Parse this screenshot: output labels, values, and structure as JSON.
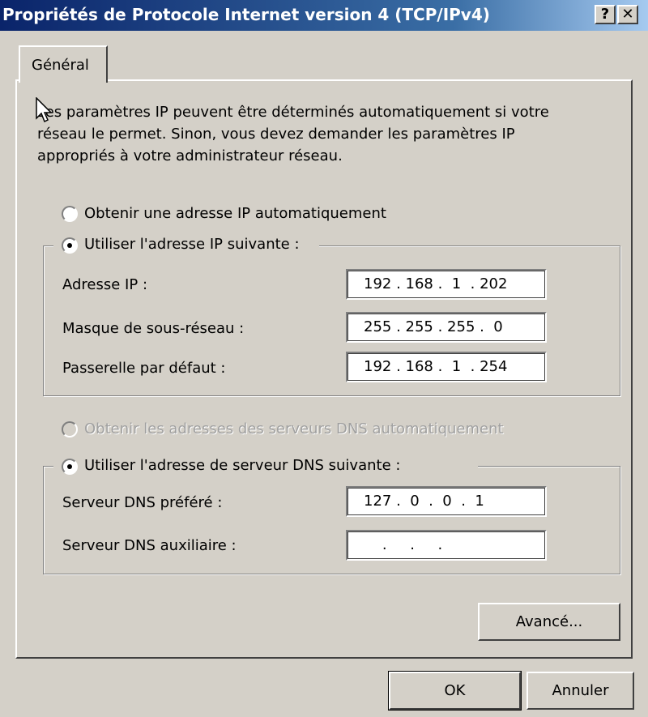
{
  "window": {
    "title": "Propriétés de Protocole Internet version 4 (TCP/IPv4)",
    "help_button": "?",
    "close_button": "✕"
  },
  "tabs": [
    {
      "label": "Général",
      "active": true
    }
  ],
  "intro_text": "Les paramètres IP peuvent être déterminés automatiquement si votre réseau le permet. Sinon, vous devez demander les paramètres IP appropriés à votre administrateur réseau.",
  "ip_section": {
    "auto_option": {
      "label": "Obtenir une adresse IP automatiquement",
      "selected": false
    },
    "manual_option": {
      "label": "Utiliser l'adresse IP suivante :",
      "selected": true
    },
    "fields": [
      {
        "label": "Adresse IP :",
        "value": "192 . 168 .  1  . 202"
      },
      {
        "label": "Masque de sous-réseau :",
        "value": "255 . 255 . 255 .  0"
      },
      {
        "label": "Passerelle par défaut :",
        "value": "192 . 168 .  1  . 254"
      }
    ]
  },
  "dns_section": {
    "auto_option": {
      "label": "Obtenir les adresses des serveurs DNS automatiquement",
      "selected": false,
      "disabled": true
    },
    "manual_option": {
      "label": "Utiliser l'adresse de serveur DNS suivante :",
      "selected": true
    },
    "fields": [
      {
        "label": "Serveur DNS préféré :",
        "value": "127 .  0  .  0  .  1"
      },
      {
        "label": "Serveur DNS auxiliaire :",
        "value": "    .     .     ."
      }
    ]
  },
  "buttons": {
    "advanced": "Avancé...",
    "ok": "OK",
    "cancel": "Annuler"
  }
}
